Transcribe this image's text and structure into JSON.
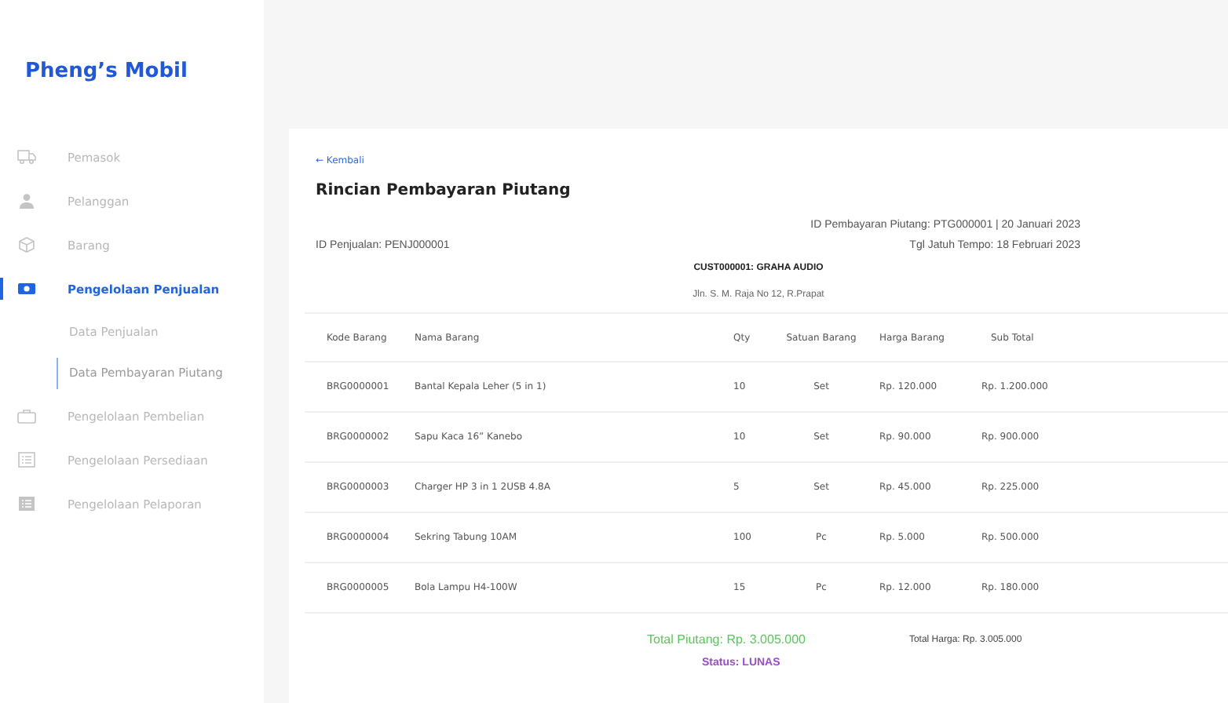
{
  "sidebar": {
    "logo": "Pheng’s Mobil",
    "items": [
      {
        "label": "Pemasok",
        "selected": false
      },
      {
        "label": "Pelanggan",
        "selected": false
      },
      {
        "label": "Barang",
        "selected": false
      },
      {
        "label": "Pengelolaan Penjualan",
        "selected": true,
        "children": [
          {
            "label": "Data Penjualan",
            "selected": false
          },
          {
            "label": "Data Pembayaran Piutang",
            "selected": true
          }
        ]
      },
      {
        "label": "Pengelolaan Pembelian",
        "selected": false
      },
      {
        "label": "Pengelolaan Persediaan",
        "selected": false
      },
      {
        "label": "Pengelolaan Pelaporan",
        "selected": false
      }
    ]
  },
  "detail": {
    "back": "← Kembali",
    "title": "Rincian Pembayaran Piutang",
    "payment_id": "ID Pembayaran Piutang: PTG000001 | 20  Januari 2023",
    "sale_id": "ID Penjualan: PENJ000001",
    "due_date": "Tgl Jatuh Tempo: 18  Februari 2023",
    "customer": "CUST000001: GRAHA AUDIO",
    "address": "Jln. S. M. Raja No 12, R.Prapat",
    "table": {
      "columns": [
        "Kode Barang",
        "Nama Barang",
        "Qty",
        "Satuan Barang",
        "Harga Barang",
        "Sub Total"
      ],
      "rows": [
        [
          "BRG0000001",
          "Bantal Kepala Leher (5 in 1)",
          "10",
          "Set",
          "Rp. 120.000",
          "Rp. 1.200.000"
        ],
        [
          "BRG0000002",
          "Sapu Kaca 16” Kanebo",
          "10",
          "Set",
          "Rp. 90.000",
          "Rp. 900.000"
        ],
        [
          "BRG0000003",
          "Charger HP 3 in 1 2USB 4.8A",
          "5",
          "Set",
          "Rp. 45.000",
          "Rp. 225.000"
        ],
        [
          "BRG0000004",
          "Sekring Tabung 10AM",
          "100",
          "Pc",
          "Rp. 5.000",
          "Rp. 500.000"
        ],
        [
          "BRG0000005",
          "Bola Lampu H4-100W",
          "15",
          "Pc",
          "Rp. 12.000",
          "Rp. 180.000"
        ]
      ]
    },
    "total_receivable": "Total Piutang: Rp. 3.005.000",
    "total_price": "Total Harga: Rp. 3.005.000",
    "status": "Status: LUNAS"
  }
}
